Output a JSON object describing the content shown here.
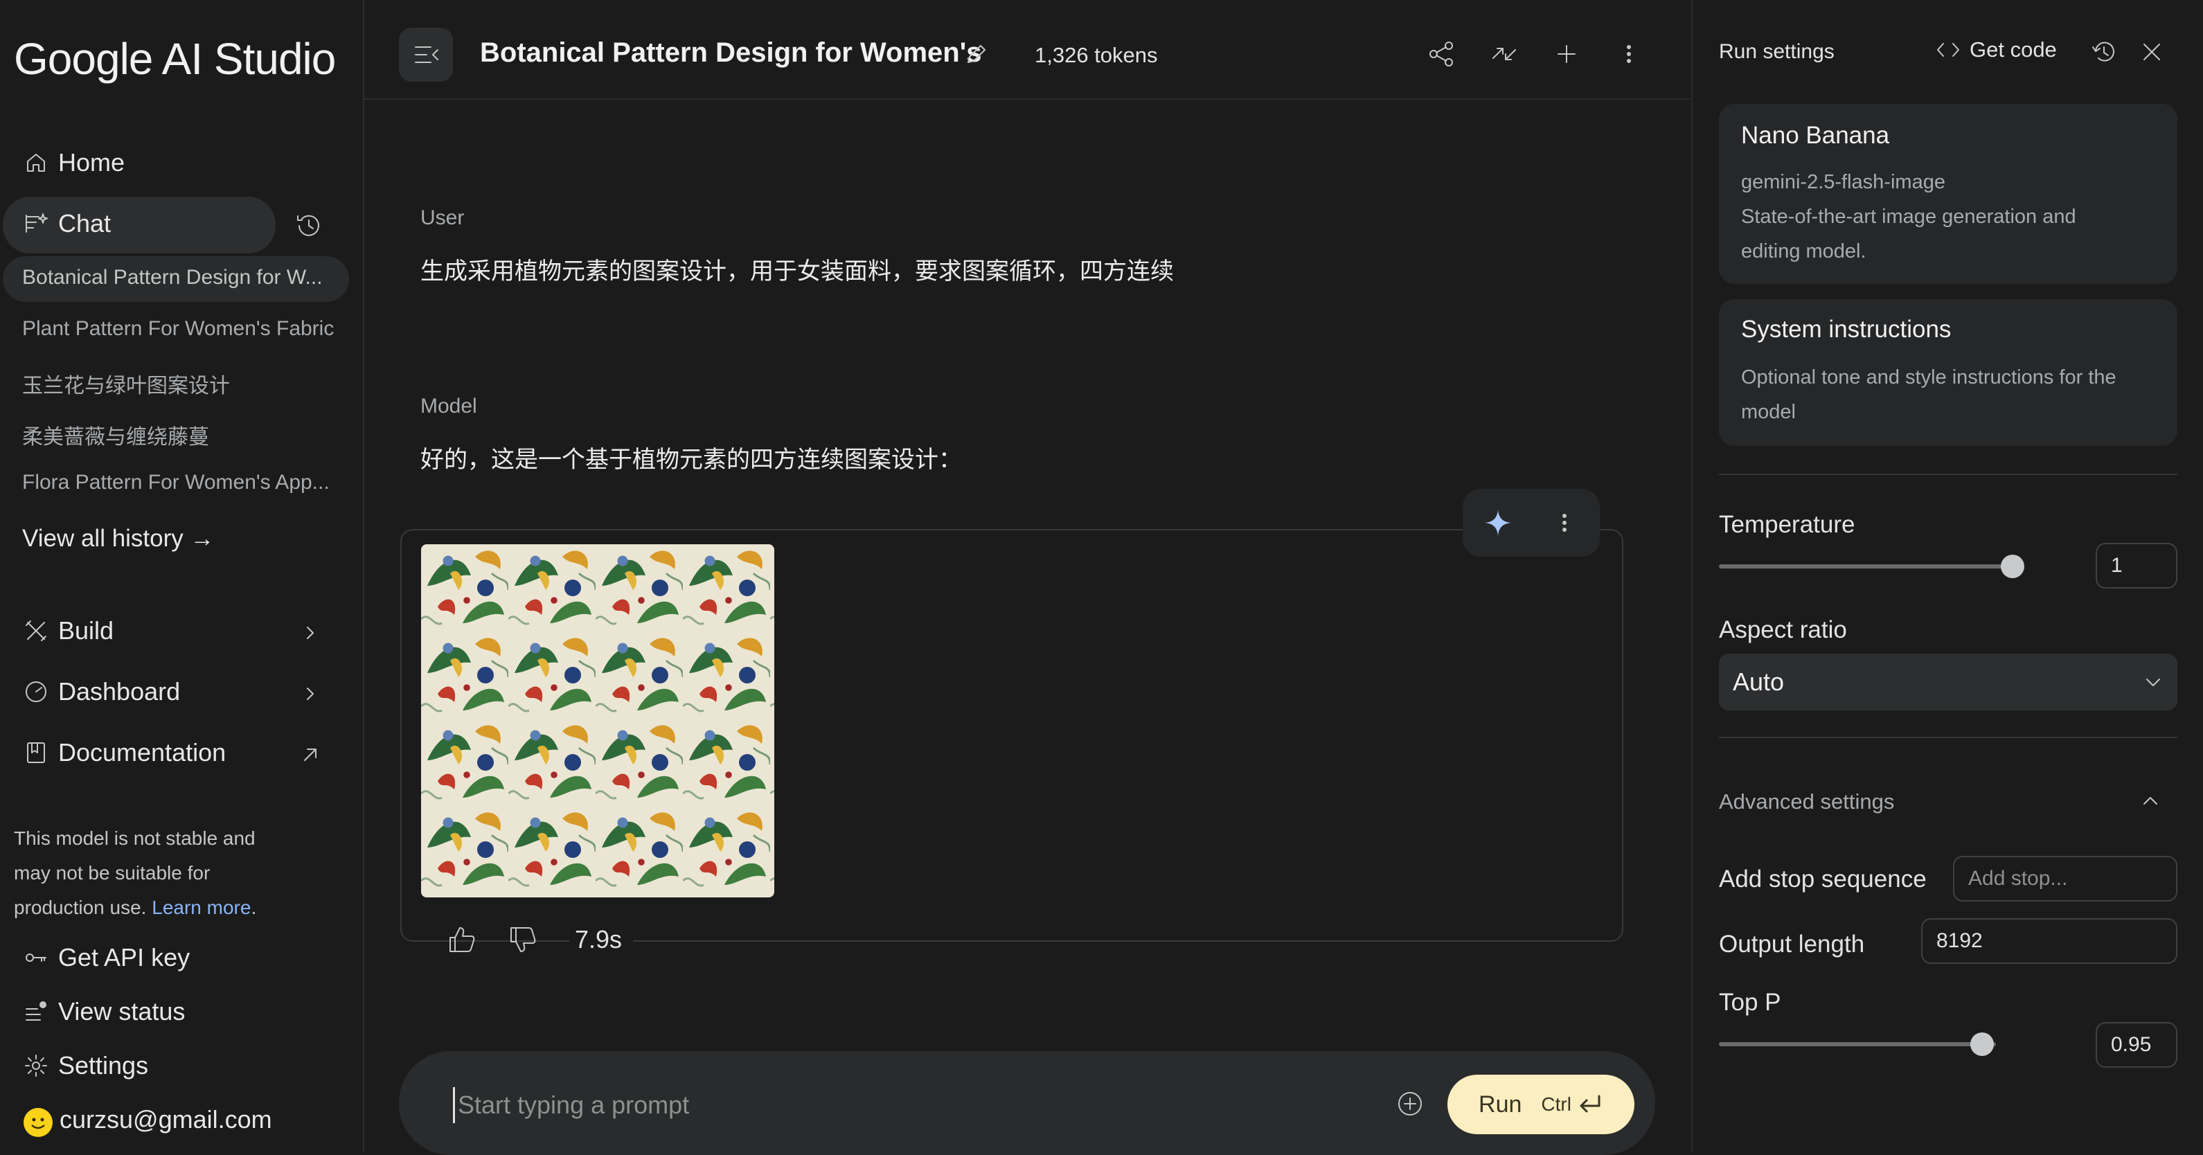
{
  "app": {
    "logo": "Google AI Studio"
  },
  "sidebar": {
    "home": "Home",
    "chat": "Chat",
    "history": [
      "Botanical Pattern Design for W...",
      "Plant Pattern For Women's Fabric",
      "玉兰花与绿叶图案设计",
      "柔美蔷薇与缠绕藤蔓",
      "Flora Pattern For Women's App..."
    ],
    "view_all": "View all history →",
    "build": "Build",
    "dashboard": "Dashboard",
    "documentation": "Documentation",
    "disclaimer_lines": [
      "This model is not stable and",
      "may not be suitable for",
      "production use."
    ],
    "learn_more": "Learn more",
    "api_key": "Get API key",
    "status": "View status",
    "settings": "Settings",
    "account": "curzsu@gmail.com"
  },
  "header": {
    "title": "Botanical Pattern Design for Women's",
    "tokens": "1,326 tokens"
  },
  "conversation": {
    "user_role": "User",
    "user_text": "生成采用植物元素的图案设计，用于女装面料，要求图案循环，四方连续",
    "model_role": "Model",
    "model_text": "好的，这是一个基于植物元素的四方连续图案设计：",
    "elapsed": "7.9s"
  },
  "prompt": {
    "placeholder": "Start typing a prompt",
    "run": "Run",
    "shortcut": "Ctrl"
  },
  "run_settings": {
    "title": "Run settings",
    "get_code": "Get code",
    "model": {
      "name": "Nano Banana",
      "id": "gemini-2.5-flash-image",
      "desc_lines": [
        "State-of-the-art image generation and",
        "editing model."
      ]
    },
    "system": {
      "title": "System instructions",
      "desc_lines": [
        "Optional tone and style instructions for the",
        "model"
      ]
    },
    "temperature": {
      "label": "Temperature",
      "value": "1",
      "level": 1.0
    },
    "aspect": {
      "label": "Aspect ratio",
      "value": "Auto"
    },
    "advanced": "Advanced settings",
    "stop": {
      "label": "Add stop sequence",
      "placeholder": "Add stop..."
    },
    "output": {
      "label": "Output length",
      "value": "8192"
    },
    "top_p": {
      "label": "Top P",
      "value": "0.95",
      "level": 0.95
    }
  },
  "colors": {
    "accent_run": "#fbeec0",
    "link": "#8ab4f8",
    "spark": "#a8c7fa"
  }
}
